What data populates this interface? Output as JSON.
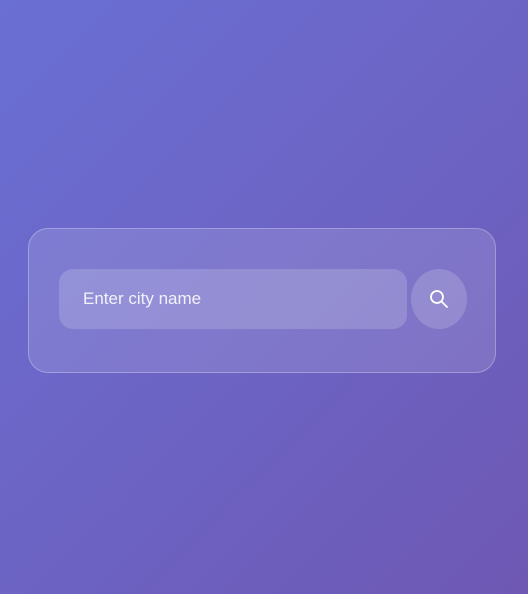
{
  "search": {
    "placeholder": "Enter city name",
    "value": "",
    "button_icon": "search-icon"
  },
  "colors": {
    "background_start": "#6a6fd4",
    "background_end": "#6e58b4",
    "text": "#ffffff"
  }
}
